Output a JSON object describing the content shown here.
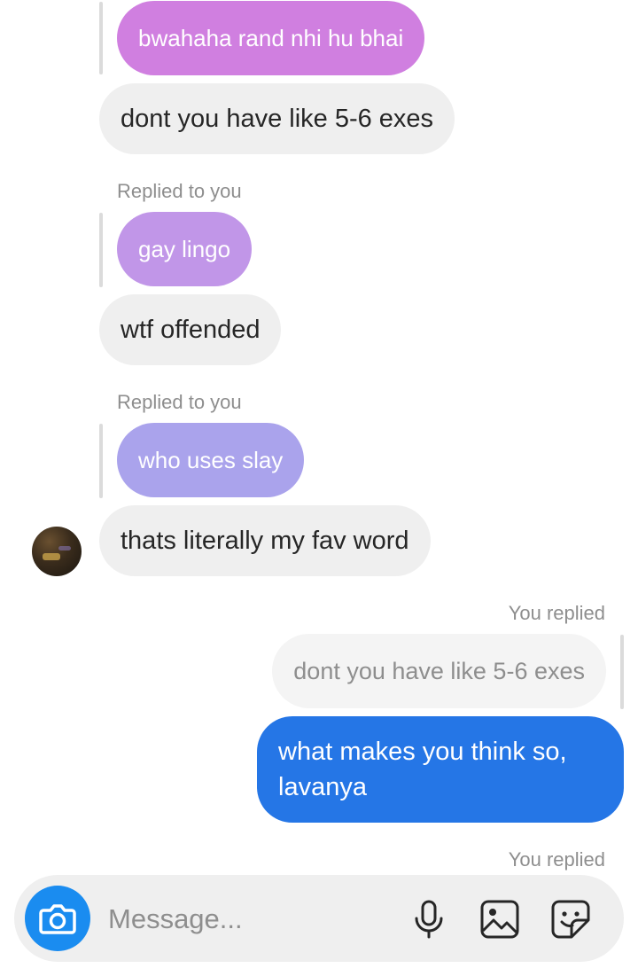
{
  "conversation": {
    "messages": [
      {
        "text": "bwahaha rand nhi hu bhai"
      },
      {
        "text": "dont you have like 5-6 exes"
      },
      {
        "replied_label": "Replied to you",
        "quote": "gay lingo"
      },
      {
        "text": "wtf offended"
      },
      {
        "replied_label": "Replied to you",
        "quote": "who uses slay"
      },
      {
        "text": "thats literally my fav word"
      },
      {
        "replied_label": "You replied",
        "quote": "dont you have like 5-6 exes"
      },
      {
        "text_line1": "what makes you think so,",
        "text_line2": "lavanya"
      },
      {
        "replied_label": "You replied"
      }
    ]
  },
  "composer": {
    "placeholder": "Message..."
  },
  "icons": {
    "camera": "camera-icon",
    "microphone": "microphone-icon",
    "gallery": "gallery-icon",
    "sticker": "sticker-icon"
  },
  "colors": {
    "quote_pink": "#d07fe0",
    "quote_purple": "#b99ae6",
    "quote_lavender": "#a9a2ec",
    "sent_blue": "#2576e6",
    "received_gray": "#efefef",
    "camera_blue": "#1a8cf0"
  }
}
